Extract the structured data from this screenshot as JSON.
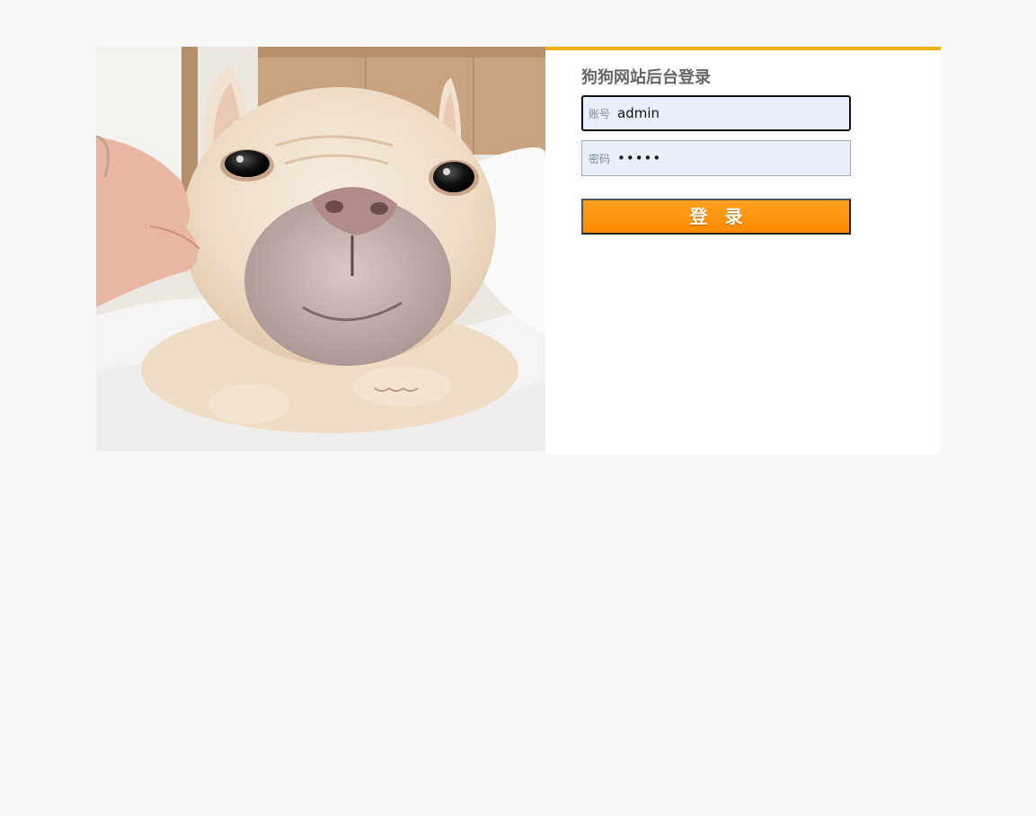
{
  "login": {
    "title": "狗狗网站后台登录",
    "username_label": "账号",
    "username_value": "admin",
    "password_label": "密码",
    "password_value": "•••••",
    "submit_label": "登 录"
  },
  "colors": {
    "accent_top_border": "#f0b014",
    "button": "#ff9400",
    "input_background": "#e8f0fe",
    "page_background": "#f7f7f7"
  },
  "image": {
    "subject": "french bulldog photo"
  }
}
